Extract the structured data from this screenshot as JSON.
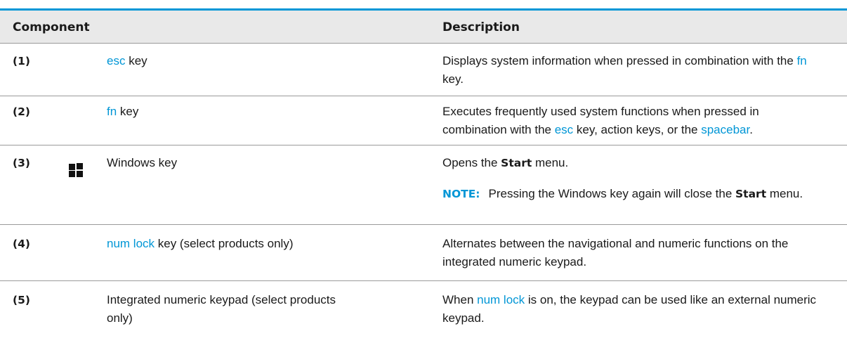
{
  "header": {
    "component": "Component",
    "description": "Description"
  },
  "rows": [
    {
      "num": "(1)",
      "comp_link": "esc",
      "comp_rest": " key",
      "desc_a": "Displays system information when pressed in combination with the ",
      "desc_link": "fn",
      "desc_b": " key."
    },
    {
      "num": "(2)",
      "comp_link": "fn",
      "comp_rest": " key",
      "desc_a": "Executes frequently used system functions when pressed in combination with the ",
      "desc_link1": "esc",
      "desc_b": " key, action keys, or the ",
      "desc_link2": "spacebar",
      "desc_c": "."
    },
    {
      "num": "(3)",
      "icon": "windows-logo-icon",
      "comp": "Windows key",
      "desc_a": "Opens the ",
      "desc_bold": "Start",
      "desc_b": " menu.",
      "note_label": "NOTE:",
      "note_a": "Pressing the Windows key again will close the ",
      "note_bold": "Start",
      "note_b": " menu."
    },
    {
      "num": "(4)",
      "comp_link": "num lock",
      "comp_rest": " key (select products only)",
      "desc": "Alternates between the navigational and numeric functions on the integrated numeric keypad."
    },
    {
      "num": "(5)",
      "comp": "Integrated numeric keypad (select products only)",
      "desc_a": "When ",
      "desc_link": "num lock",
      "desc_b": " is on, the keypad can be used like an external numeric keypad."
    }
  ],
  "colors": {
    "accent": "#0096d6",
    "header_bg": "#e9e9e9",
    "rule": "#9a9a9a"
  }
}
